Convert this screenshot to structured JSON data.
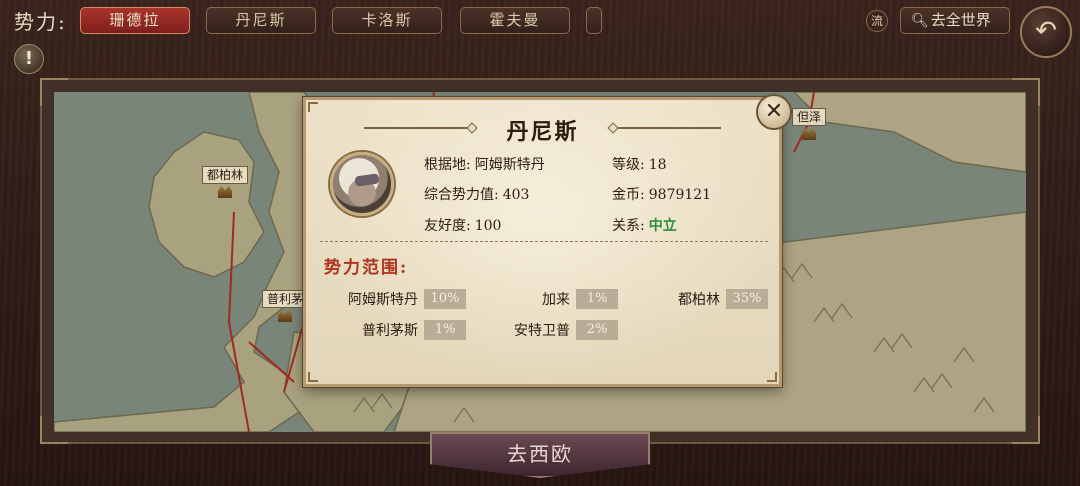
{
  "topbar": {
    "faction_label": "势力:",
    "tabs": [
      {
        "label": "珊德拉",
        "active": true
      },
      {
        "label": "丹尼斯",
        "active": false
      },
      {
        "label": "卡洛斯",
        "active": false
      },
      {
        "label": "霍夫曼",
        "active": false
      }
    ],
    "liu_label": "流",
    "world_icon": "search-icon",
    "world_label": "去全世界",
    "back_icon": "return-arrow-icon",
    "alert_icon": "exclamation-icon"
  },
  "map": {
    "cities": [
      {
        "name": "都柏林"
      },
      {
        "name": "普利茅"
      },
      {
        "name": "但泽"
      }
    ],
    "go_button": "去西欧"
  },
  "dialog": {
    "title": "丹尼斯",
    "close_icon": "close-icon",
    "base_label": "根据地:",
    "base_value": "阿姆斯特丹",
    "level_label": "等级:",
    "level_value": "18",
    "power_label": "综合势力值:",
    "power_value": "403",
    "gold_label": "金币:",
    "gold_value": "9879121",
    "friendship_label": "友好度:",
    "friendship_value": "100",
    "relation_label": "关系:",
    "relation_value": "中立",
    "range_title": "势力范围:",
    "range": [
      {
        "name": "阿姆斯特丹",
        "pct": "10%"
      },
      {
        "name": "加来",
        "pct": "1%"
      },
      {
        "name": "都柏林",
        "pct": "35%"
      },
      {
        "name": "普利茅斯",
        "pct": "1%"
      },
      {
        "name": "安特卫普",
        "pct": "2%"
      }
    ]
  },
  "colors": {
    "active_tab": "#a9342c",
    "relation_neutral": "#2f8a3e",
    "range_title": "#b0321f",
    "border_red": "#a02a22"
  }
}
